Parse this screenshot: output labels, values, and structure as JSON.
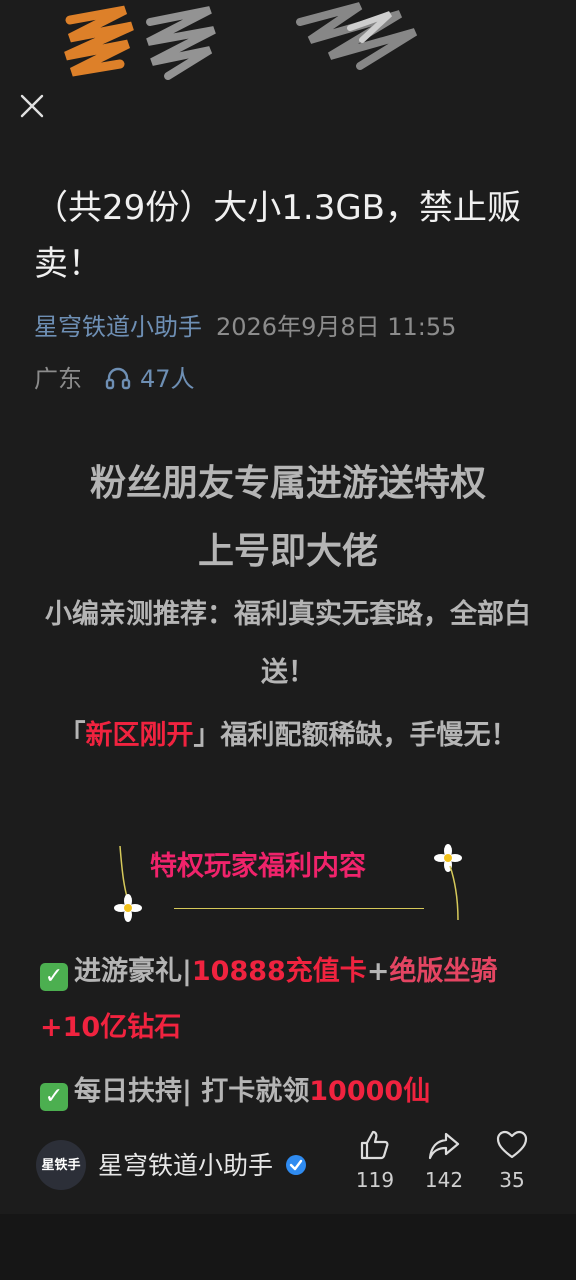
{
  "header": {
    "close_icon": "close-icon"
  },
  "article": {
    "title": "（共29份）大小1.3GB，禁止贩卖！",
    "author": "星穹铁道小助手",
    "datetime": "2026年9月8日 11:55",
    "region": "广东",
    "listeners": "47人",
    "listen_icon": "headphones-icon"
  },
  "content": {
    "headline_line1": "粉丝朋友专属进游送特权",
    "headline_line2": "上号即大佬",
    "recommend": "小编亲测推荐：福利真实无套路，全部白送！",
    "bracket_open": "「",
    "new_zone": "新区刚开",
    "bracket_rest": "」福利配额稀缺，手慢无！",
    "section_title": "特权玩家福利内容",
    "item1_label": "进游豪礼|",
    "item1_red": "10888充值卡",
    "item1_plus": "+",
    "item1_grad": "绝版坐骑",
    "item1_red2": "+10亿钻石",
    "item2_label": "每日扶持| 打卡就领",
    "item2_red": "10000仙"
  },
  "bottom_bar": {
    "avatar_text": "星铁手",
    "author": "星穹铁道小助手",
    "verified_icon": "verified-icon",
    "like_count": "119",
    "share_count": "142",
    "fav_count": "35"
  },
  "colors": {
    "background": "#1c1c1c",
    "link_blue": "#6e8fb4",
    "highlight_red": "#f0233f",
    "section_pink": "#f0236b"
  }
}
